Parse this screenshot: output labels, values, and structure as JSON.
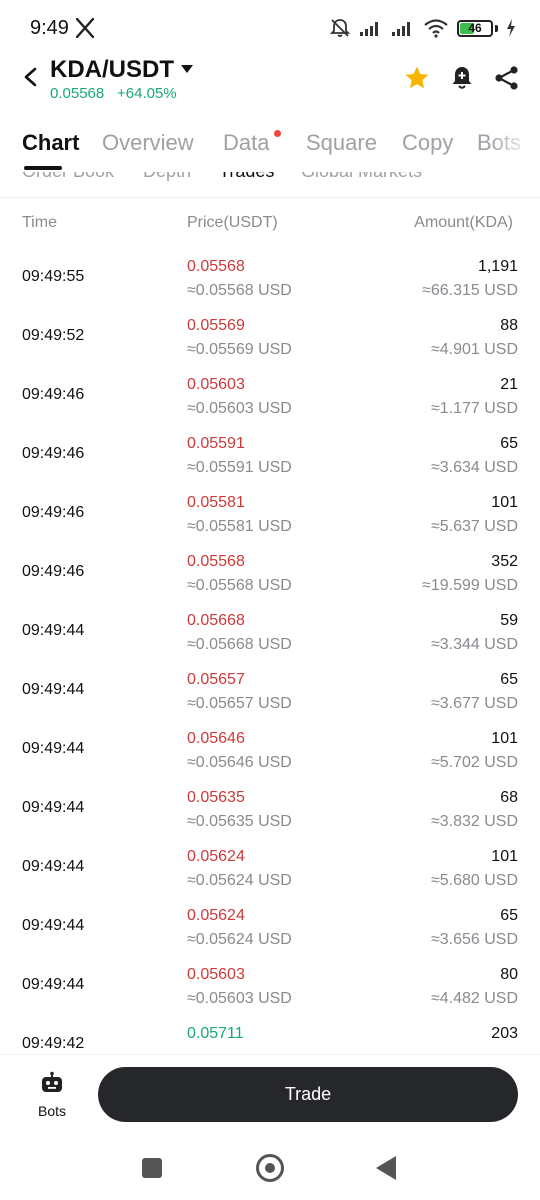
{
  "status_bar": {
    "time": "9:49",
    "battery": "46",
    "battery_level": 0.46
  },
  "header": {
    "pair": "KDA/USDT",
    "last_price": "0.05568",
    "change": "+64.05%"
  },
  "tabs": [
    "Chart",
    "Overview",
    "Data",
    "Square",
    "Copy",
    "Bots"
  ],
  "subtabs": [
    "Order Book",
    "Depth",
    "Trades",
    "Global Markets"
  ],
  "columns": {
    "time": "Time",
    "price": "Price(USDT)",
    "amount": "Amount(KDA)"
  },
  "trades": [
    {
      "time": "09:49:55",
      "price": "0.05568",
      "price_usd": "≈0.05568 USD",
      "amount": "1,191",
      "amount_usd": "≈66.315 USD",
      "side": "sell"
    },
    {
      "time": "09:49:52",
      "price": "0.05569",
      "price_usd": "≈0.05569 USD",
      "amount": "88",
      "amount_usd": "≈4.901 USD",
      "side": "sell"
    },
    {
      "time": "09:49:46",
      "price": "0.05603",
      "price_usd": "≈0.05603 USD",
      "amount": "21",
      "amount_usd": "≈1.177 USD",
      "side": "sell"
    },
    {
      "time": "09:49:46",
      "price": "0.05591",
      "price_usd": "≈0.05591 USD",
      "amount": "65",
      "amount_usd": "≈3.634 USD",
      "side": "sell"
    },
    {
      "time": "09:49:46",
      "price": "0.05581",
      "price_usd": "≈0.05581 USD",
      "amount": "101",
      "amount_usd": "≈5.637 USD",
      "side": "sell"
    },
    {
      "time": "09:49:46",
      "price": "0.05568",
      "price_usd": "≈0.05568 USD",
      "amount": "352",
      "amount_usd": "≈19.599 USD",
      "side": "sell"
    },
    {
      "time": "09:49:44",
      "price": "0.05668",
      "price_usd": "≈0.05668 USD",
      "amount": "59",
      "amount_usd": "≈3.344 USD",
      "side": "sell"
    },
    {
      "time": "09:49:44",
      "price": "0.05657",
      "price_usd": "≈0.05657 USD",
      "amount": "65",
      "amount_usd": "≈3.677 USD",
      "side": "sell"
    },
    {
      "time": "09:49:44",
      "price": "0.05646",
      "price_usd": "≈0.05646 USD",
      "amount": "101",
      "amount_usd": "≈5.702 USD",
      "side": "sell"
    },
    {
      "time": "09:49:44",
      "price": "0.05635",
      "price_usd": "≈0.05635 USD",
      "amount": "68",
      "amount_usd": "≈3.832 USD",
      "side": "sell"
    },
    {
      "time": "09:49:44",
      "price": "0.05624",
      "price_usd": "≈0.05624 USD",
      "amount": "101",
      "amount_usd": "≈5.680 USD",
      "side": "sell"
    },
    {
      "time": "09:49:44",
      "price": "0.05624",
      "price_usd": "≈0.05624 USD",
      "amount": "65",
      "amount_usd": "≈3.656 USD",
      "side": "sell"
    },
    {
      "time": "09:49:44",
      "price": "0.05603",
      "price_usd": "≈0.05603 USD",
      "amount": "80",
      "amount_usd": "≈4.482 USD",
      "side": "sell"
    },
    {
      "time": "09:49:42",
      "price": "0.05711",
      "price_usd": "",
      "amount": "203",
      "amount_usd": "",
      "side": "buy"
    }
  ],
  "bottom": {
    "bots_label": "Bots",
    "trade_label": "Trade"
  },
  "colors": {
    "up": "#19a974",
    "down": "#cc3a3a",
    "star": "#f7b500",
    "dot": "#f0453a"
  },
  "icons": [
    "back-icon",
    "caret-down-icon",
    "star-icon",
    "alert-bell-icon",
    "share-icon",
    "robot-icon"
  ]
}
